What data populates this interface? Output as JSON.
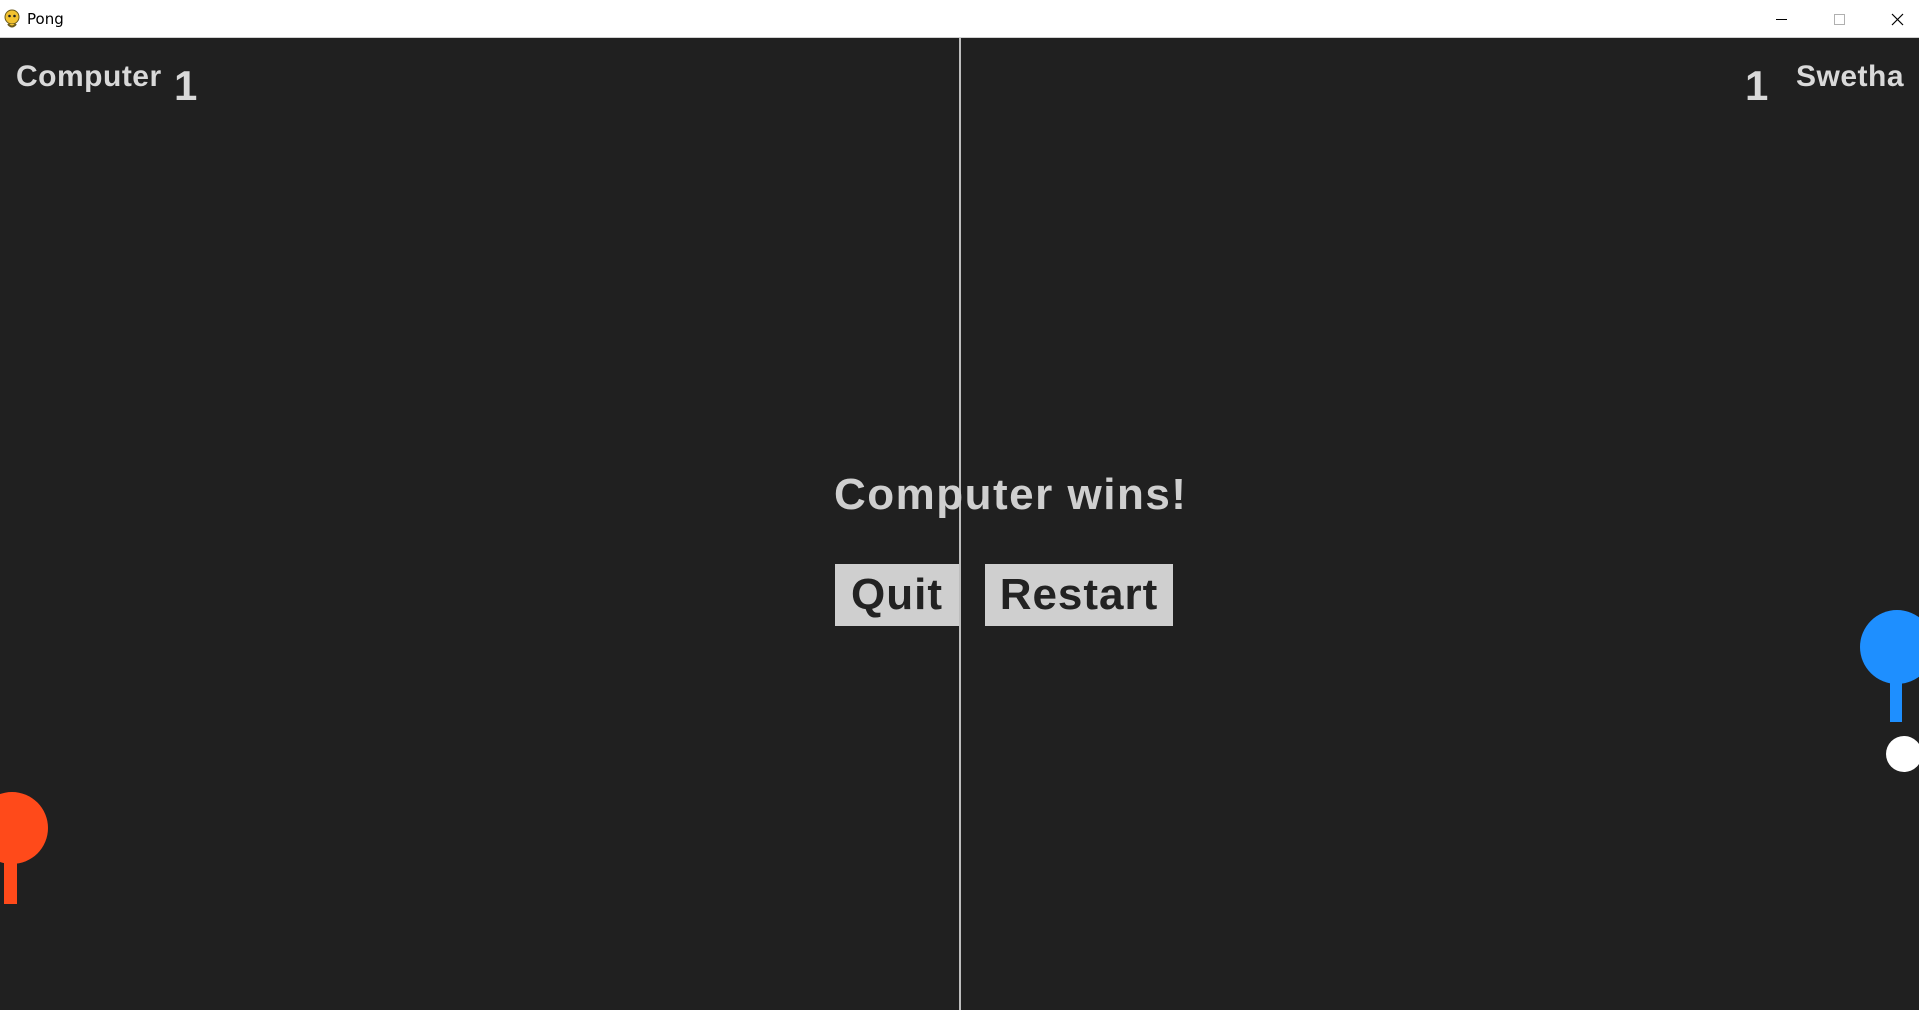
{
  "window": {
    "title": "Pong",
    "icon": "pygame-snake-icon",
    "controls": [
      "minimize-icon",
      "maximize-icon",
      "close-icon"
    ]
  },
  "game": {
    "left_player": {
      "name": "Computer",
      "score": "1",
      "paddle_color": "#ff4a1a"
    },
    "right_player": {
      "name": "Swetha",
      "score": "1",
      "paddle_color": "#1e8fff"
    },
    "result_message": "Computer wins!",
    "buttons": {
      "quit": "Quit",
      "restart": "Restart"
    },
    "colors": {
      "background": "#202020",
      "text": "#d9d9d9",
      "button_bg": "#cfcfcf",
      "ball": "#ffffff",
      "center_line": "#bdbdbd"
    }
  }
}
